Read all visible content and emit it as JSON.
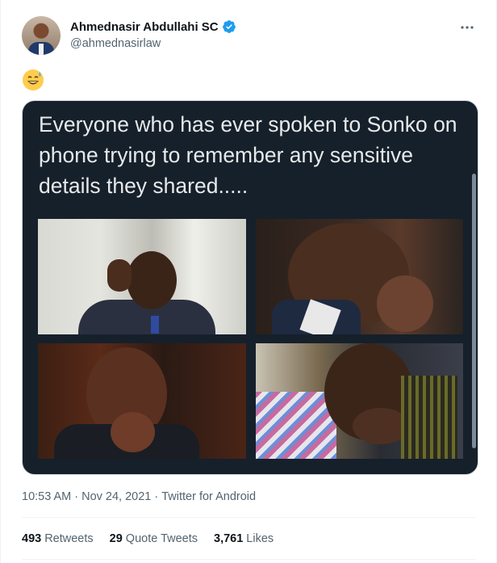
{
  "tweet": {
    "display_name": "Ahmednasir Abdullahi SC",
    "handle": "@ahmednasirlaw",
    "emoji": "😅",
    "media_caption": "Everyone who has ever spoken to Sonko on phone trying to remember any sensitive details they shared.....",
    "time": "10:53 AM",
    "date": "Nov 24, 2021",
    "source": "Twitter for Android",
    "separator": "·",
    "stats": {
      "retweets_count": "493",
      "retweets_label": "Retweets",
      "quotes_count": "29",
      "quotes_label": "Quote Tweets",
      "likes_count": "3,761",
      "likes_label": "Likes"
    }
  },
  "icons": {
    "verified": "verified-badge-icon",
    "more": "more-options-icon"
  },
  "colors": {
    "verified": "#1d9bf0",
    "secondary_text": "#536471",
    "media_bg": "#15202b"
  }
}
